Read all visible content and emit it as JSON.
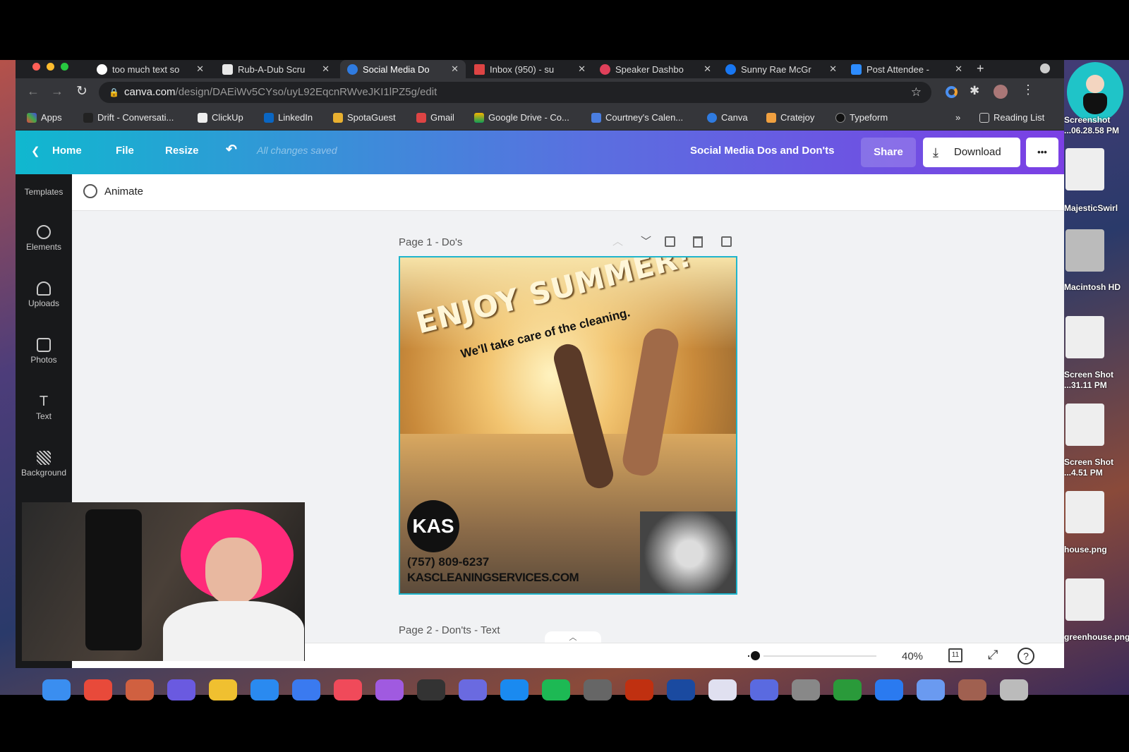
{
  "browser": {
    "tabs": [
      {
        "label": "too much text so",
        "color": "#ffffff"
      },
      {
        "label": "Rub-A-Dub Scru",
        "color": "#e8e8e8"
      },
      {
        "label": "Social Media Do",
        "color": "#2f7be0",
        "active": true
      },
      {
        "label": "Inbox (950) - su",
        "color": "#d44"
      },
      {
        "label": "Speaker Dashbo",
        "color": "#e0405a"
      },
      {
        "label": "Sunny Rae McGr",
        "color": "#1877f2"
      },
      {
        "label": "Post Attendee -",
        "color": "#2d8cff"
      }
    ],
    "url_host": "canva.com",
    "url_path": "/design/DAEiWv5CYso/uyL92EqcnRWveJKI1lPZ5g/edit",
    "bookmarks": [
      "Apps",
      "Drift - Conversati...",
      "ClickUp",
      "LinkedIn",
      "SpotaGuest",
      "Gmail",
      "Google Drive - Co...",
      "Courtney's Calen...",
      "Canva",
      "Cratejoy",
      "Typeform"
    ],
    "reading_list": "Reading List",
    "more_bookmarks": "»"
  },
  "canva": {
    "header": {
      "home": "Home",
      "file": "File",
      "resize": "Resize",
      "saved": "All changes saved",
      "title": "Social Media Dos and Don'ts",
      "share": "Share",
      "download": "Download",
      "more": "•••"
    },
    "animate": "Animate",
    "sidebar": [
      "Templates",
      "Elements",
      "Uploads",
      "Photos",
      "Text",
      "Background"
    ],
    "page1_label": "Page 1 - Do's",
    "page2_label": "Page 2 - Don'ts - Text",
    "design": {
      "headline": "ENJOY SUMMER!",
      "subline": "We'll take care of the cleaning.",
      "logo": "KAS",
      "phone": "(757) 809-6237",
      "website": "KASCLEANINGSERVICES.COM"
    },
    "zoom": "40%",
    "zoom_level": 0.4,
    "pages_count": "11",
    "help": "?"
  },
  "desktop": {
    "items": [
      {
        "label": "MajesticSwirl"
      },
      {
        "label": "Macintosh HD"
      },
      {
        "label": "Screen Shot ...31.11 PM"
      },
      {
        "label": "Screen Shot ...4.51 PM"
      },
      {
        "label": "house.png"
      },
      {
        "label": "greenhouse.png"
      }
    ],
    "top_label": "Screenshot ...06.28.58 PM"
  },
  "colors": {
    "accent": "#1fb5cc",
    "header_start": "#10b8cf",
    "header_end": "#7b3fe4"
  }
}
